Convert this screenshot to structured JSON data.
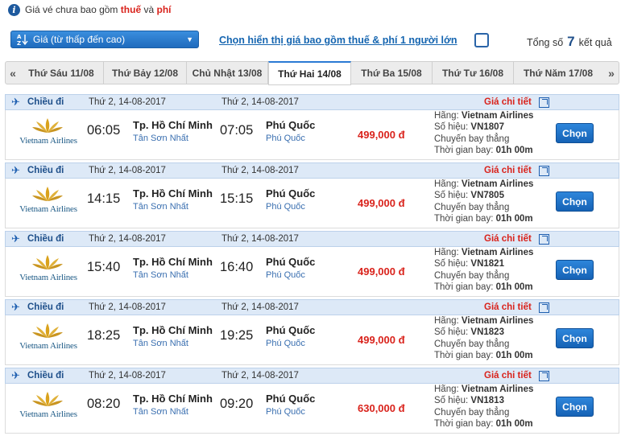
{
  "notice": {
    "prefix": "Giá vé chưa bao gồm",
    "tax": "thuế",
    "and": "và",
    "fee": "phí"
  },
  "sort": {
    "label": "Giá (từ thấp đến cao)"
  },
  "toggle": {
    "label": "Chọn hiển thị giá bao gồm thuế & phí 1 người lớn"
  },
  "total": {
    "prefix": "Tổng số",
    "count": "7",
    "suffix": "kết quả"
  },
  "date_tabs": [
    {
      "label": "Thứ Sáu 11/08",
      "active": false
    },
    {
      "label": "Thứ Bảy 12/08",
      "active": false
    },
    {
      "label": "Chủ Nhật 13/08",
      "active": false
    },
    {
      "label": "Thứ Hai 14/08",
      "active": true
    },
    {
      "label": "Thứ Ba 15/08",
      "active": false
    },
    {
      "label": "Thứ Tư 16/08",
      "active": false
    },
    {
      "label": "Thứ Năm 17/08",
      "active": false
    }
  ],
  "colors": {
    "accent": "#1f6bbd",
    "price": "#d9231c",
    "header_bg": "#dde9f7"
  },
  "labels": {
    "direction": "Chiều đi",
    "price_detail": "Giá chi tiết",
    "airline_prefix": "Hãng:",
    "flight_no_prefix": "Số hiệu:",
    "direct": "Chuyến bay thẳng",
    "duration_prefix": "Thời gian bay:",
    "select": "Chọn",
    "airline_logo_text": "Vietnam Airlines"
  },
  "flights": [
    {
      "date_dep": "Thứ 2, 14-08-2017",
      "date_arr": "Thứ 2, 14-08-2017",
      "dep_time": "06:05",
      "dep_city": "Tp. Hồ Chí Minh",
      "dep_airport": "Tân Sơn Nhất",
      "arr_time": "07:05",
      "arr_city": "Phú Quốc",
      "arr_airport": "Phú Quốc",
      "price": "499,000 đ",
      "airline": "Vietnam Airlines",
      "flight_no": "VN1807",
      "duration": "01h 00m"
    },
    {
      "date_dep": "Thứ 2, 14-08-2017",
      "date_arr": "Thứ 2, 14-08-2017",
      "dep_time": "14:15",
      "dep_city": "Tp. Hồ Chí Minh",
      "dep_airport": "Tân Sơn Nhất",
      "arr_time": "15:15",
      "arr_city": "Phú Quốc",
      "arr_airport": "Phú Quốc",
      "price": "499,000 đ",
      "airline": "Vietnam Airlines",
      "flight_no": "VN7805",
      "duration": "01h 00m"
    },
    {
      "date_dep": "Thứ 2, 14-08-2017",
      "date_arr": "Thứ 2, 14-08-2017",
      "dep_time": "15:40",
      "dep_city": "Tp. Hồ Chí Minh",
      "dep_airport": "Tân Sơn Nhất",
      "arr_time": "16:40",
      "arr_city": "Phú Quốc",
      "arr_airport": "Phú Quốc",
      "price": "499,000 đ",
      "airline": "Vietnam Airlines",
      "flight_no": "VN1821",
      "duration": "01h 00m"
    },
    {
      "date_dep": "Thứ 2, 14-08-2017",
      "date_arr": "Thứ 2, 14-08-2017",
      "dep_time": "18:25",
      "dep_city": "Tp. Hồ Chí Minh",
      "dep_airport": "Tân Sơn Nhất",
      "arr_time": "19:25",
      "arr_city": "Phú Quốc",
      "arr_airport": "Phú Quốc",
      "price": "499,000 đ",
      "airline": "Vietnam Airlines",
      "flight_no": "VN1823",
      "duration": "01h 00m"
    },
    {
      "date_dep": "Thứ 2, 14-08-2017",
      "date_arr": "Thứ 2, 14-08-2017",
      "dep_time": "08:20",
      "dep_city": "Tp. Hồ Chí Minh",
      "dep_airport": "Tân Sơn Nhất",
      "arr_time": "09:20",
      "arr_city": "Phú Quốc",
      "arr_airport": "Phú Quốc",
      "price": "630,000 đ",
      "airline": "Vietnam Airlines",
      "flight_no": "VN1813",
      "duration": "01h 00m"
    }
  ]
}
